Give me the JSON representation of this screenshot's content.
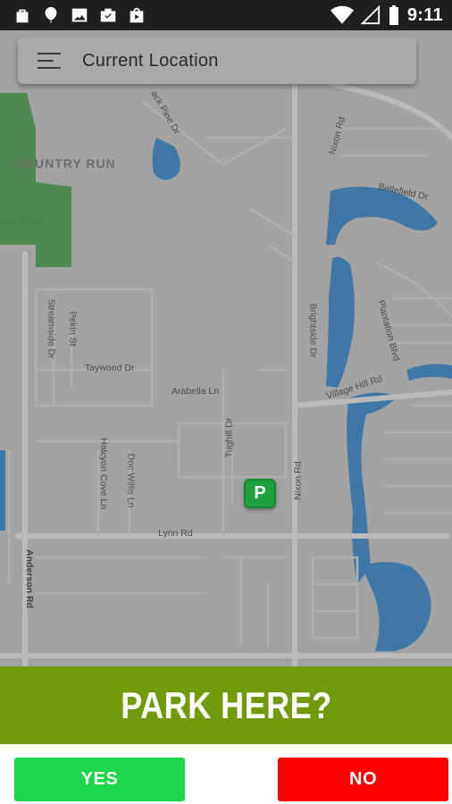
{
  "status_bar": {
    "time": "9:11",
    "icons_left": [
      "bag-icon",
      "balloon-icon",
      "image-icon",
      "briefcase-check-icon",
      "shop-bag-icon"
    ],
    "icons_right": [
      "wifi-icon",
      "signal-icon",
      "battery-icon"
    ]
  },
  "header": {
    "menu_icon": "menu-icon",
    "title": "Current Location"
  },
  "map": {
    "labels": {
      "country_run": "COUNTRY RUN",
      "park": "zun Park",
      "jack_pine": "ack Pine Dr",
      "nixon_rd_top": "Nixon Rd",
      "bellefield": "Bellefield Dr",
      "streamside": "Streamside Dr",
      "pekingst": "Pekin St",
      "brightside": "Brightside Dr",
      "plantation": "Plantation Blvd",
      "taywood": "Taywood Dr",
      "arabella": "Arabella Ln",
      "village_hill": "Village Hill Rd",
      "tughill": "Tughill Dr",
      "halcyon": "Halcyon Cove Ln",
      "doc_willis": "Doc Willis Ln",
      "nixon_rd": "Nixon Rd",
      "lynn": "Lynn Rd",
      "anderson": "Anderson Rd"
    },
    "pin_label": "P"
  },
  "banner": {
    "text": "PARK HERE?"
  },
  "actions": {
    "yes_label": "YES",
    "no_label": "NO"
  },
  "colors": {
    "banner": "#739a0d",
    "yes": "#1ed64a",
    "no": "#ff0000",
    "pin": "#19a33a"
  }
}
